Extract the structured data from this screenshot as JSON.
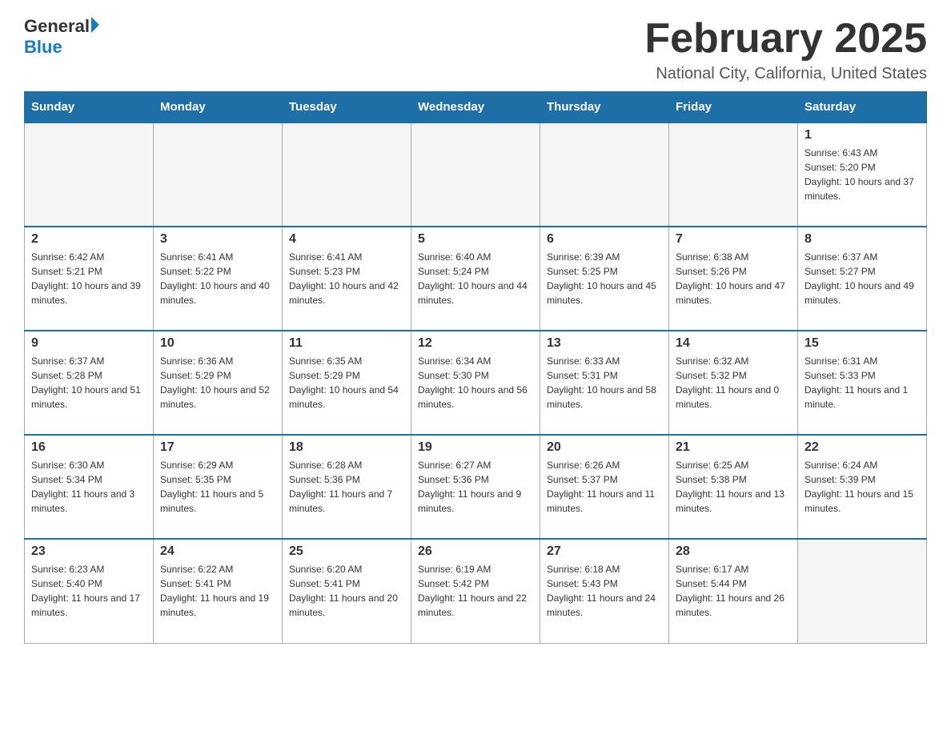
{
  "header": {
    "logo_general": "General",
    "logo_blue": "Blue",
    "month_title": "February 2025",
    "location": "National City, California, United States"
  },
  "days_of_week": [
    "Sunday",
    "Monday",
    "Tuesday",
    "Wednesday",
    "Thursday",
    "Friday",
    "Saturday"
  ],
  "weeks": [
    [
      {
        "day": "",
        "sunrise": "",
        "sunset": "",
        "daylight": "",
        "empty": true
      },
      {
        "day": "",
        "sunrise": "",
        "sunset": "",
        "daylight": "",
        "empty": true
      },
      {
        "day": "",
        "sunrise": "",
        "sunset": "",
        "daylight": "",
        "empty": true
      },
      {
        "day": "",
        "sunrise": "",
        "sunset": "",
        "daylight": "",
        "empty": true
      },
      {
        "day": "",
        "sunrise": "",
        "sunset": "",
        "daylight": "",
        "empty": true
      },
      {
        "day": "",
        "sunrise": "",
        "sunset": "",
        "daylight": "",
        "empty": true
      },
      {
        "day": "1",
        "sunrise": "Sunrise: 6:43 AM",
        "sunset": "Sunset: 5:20 PM",
        "daylight": "Daylight: 10 hours and 37 minutes.",
        "empty": false
      }
    ],
    [
      {
        "day": "2",
        "sunrise": "Sunrise: 6:42 AM",
        "sunset": "Sunset: 5:21 PM",
        "daylight": "Daylight: 10 hours and 39 minutes.",
        "empty": false
      },
      {
        "day": "3",
        "sunrise": "Sunrise: 6:41 AM",
        "sunset": "Sunset: 5:22 PM",
        "daylight": "Daylight: 10 hours and 40 minutes.",
        "empty": false
      },
      {
        "day": "4",
        "sunrise": "Sunrise: 6:41 AM",
        "sunset": "Sunset: 5:23 PM",
        "daylight": "Daylight: 10 hours and 42 minutes.",
        "empty": false
      },
      {
        "day": "5",
        "sunrise": "Sunrise: 6:40 AM",
        "sunset": "Sunset: 5:24 PM",
        "daylight": "Daylight: 10 hours and 44 minutes.",
        "empty": false
      },
      {
        "day": "6",
        "sunrise": "Sunrise: 6:39 AM",
        "sunset": "Sunset: 5:25 PM",
        "daylight": "Daylight: 10 hours and 45 minutes.",
        "empty": false
      },
      {
        "day": "7",
        "sunrise": "Sunrise: 6:38 AM",
        "sunset": "Sunset: 5:26 PM",
        "daylight": "Daylight: 10 hours and 47 minutes.",
        "empty": false
      },
      {
        "day": "8",
        "sunrise": "Sunrise: 6:37 AM",
        "sunset": "Sunset: 5:27 PM",
        "daylight": "Daylight: 10 hours and 49 minutes.",
        "empty": false
      }
    ],
    [
      {
        "day": "9",
        "sunrise": "Sunrise: 6:37 AM",
        "sunset": "Sunset: 5:28 PM",
        "daylight": "Daylight: 10 hours and 51 minutes.",
        "empty": false
      },
      {
        "day": "10",
        "sunrise": "Sunrise: 6:36 AM",
        "sunset": "Sunset: 5:29 PM",
        "daylight": "Daylight: 10 hours and 52 minutes.",
        "empty": false
      },
      {
        "day": "11",
        "sunrise": "Sunrise: 6:35 AM",
        "sunset": "Sunset: 5:29 PM",
        "daylight": "Daylight: 10 hours and 54 minutes.",
        "empty": false
      },
      {
        "day": "12",
        "sunrise": "Sunrise: 6:34 AM",
        "sunset": "Sunset: 5:30 PM",
        "daylight": "Daylight: 10 hours and 56 minutes.",
        "empty": false
      },
      {
        "day": "13",
        "sunrise": "Sunrise: 6:33 AM",
        "sunset": "Sunset: 5:31 PM",
        "daylight": "Daylight: 10 hours and 58 minutes.",
        "empty": false
      },
      {
        "day": "14",
        "sunrise": "Sunrise: 6:32 AM",
        "sunset": "Sunset: 5:32 PM",
        "daylight": "Daylight: 11 hours and 0 minutes.",
        "empty": false
      },
      {
        "day": "15",
        "sunrise": "Sunrise: 6:31 AM",
        "sunset": "Sunset: 5:33 PM",
        "daylight": "Daylight: 11 hours and 1 minute.",
        "empty": false
      }
    ],
    [
      {
        "day": "16",
        "sunrise": "Sunrise: 6:30 AM",
        "sunset": "Sunset: 5:34 PM",
        "daylight": "Daylight: 11 hours and 3 minutes.",
        "empty": false
      },
      {
        "day": "17",
        "sunrise": "Sunrise: 6:29 AM",
        "sunset": "Sunset: 5:35 PM",
        "daylight": "Daylight: 11 hours and 5 minutes.",
        "empty": false
      },
      {
        "day": "18",
        "sunrise": "Sunrise: 6:28 AM",
        "sunset": "Sunset: 5:36 PM",
        "daylight": "Daylight: 11 hours and 7 minutes.",
        "empty": false
      },
      {
        "day": "19",
        "sunrise": "Sunrise: 6:27 AM",
        "sunset": "Sunset: 5:36 PM",
        "daylight": "Daylight: 11 hours and 9 minutes.",
        "empty": false
      },
      {
        "day": "20",
        "sunrise": "Sunrise: 6:26 AM",
        "sunset": "Sunset: 5:37 PM",
        "daylight": "Daylight: 11 hours and 11 minutes.",
        "empty": false
      },
      {
        "day": "21",
        "sunrise": "Sunrise: 6:25 AM",
        "sunset": "Sunset: 5:38 PM",
        "daylight": "Daylight: 11 hours and 13 minutes.",
        "empty": false
      },
      {
        "day": "22",
        "sunrise": "Sunrise: 6:24 AM",
        "sunset": "Sunset: 5:39 PM",
        "daylight": "Daylight: 11 hours and 15 minutes.",
        "empty": false
      }
    ],
    [
      {
        "day": "23",
        "sunrise": "Sunrise: 6:23 AM",
        "sunset": "Sunset: 5:40 PM",
        "daylight": "Daylight: 11 hours and 17 minutes.",
        "empty": false
      },
      {
        "day": "24",
        "sunrise": "Sunrise: 6:22 AM",
        "sunset": "Sunset: 5:41 PM",
        "daylight": "Daylight: 11 hours and 19 minutes.",
        "empty": false
      },
      {
        "day": "25",
        "sunrise": "Sunrise: 6:20 AM",
        "sunset": "Sunset: 5:41 PM",
        "daylight": "Daylight: 11 hours and 20 minutes.",
        "empty": false
      },
      {
        "day": "26",
        "sunrise": "Sunrise: 6:19 AM",
        "sunset": "Sunset: 5:42 PM",
        "daylight": "Daylight: 11 hours and 22 minutes.",
        "empty": false
      },
      {
        "day": "27",
        "sunrise": "Sunrise: 6:18 AM",
        "sunset": "Sunset: 5:43 PM",
        "daylight": "Daylight: 11 hours and 24 minutes.",
        "empty": false
      },
      {
        "day": "28",
        "sunrise": "Sunrise: 6:17 AM",
        "sunset": "Sunset: 5:44 PM",
        "daylight": "Daylight: 11 hours and 26 minutes.",
        "empty": false
      },
      {
        "day": "",
        "sunrise": "",
        "sunset": "",
        "daylight": "",
        "empty": true
      }
    ]
  ]
}
